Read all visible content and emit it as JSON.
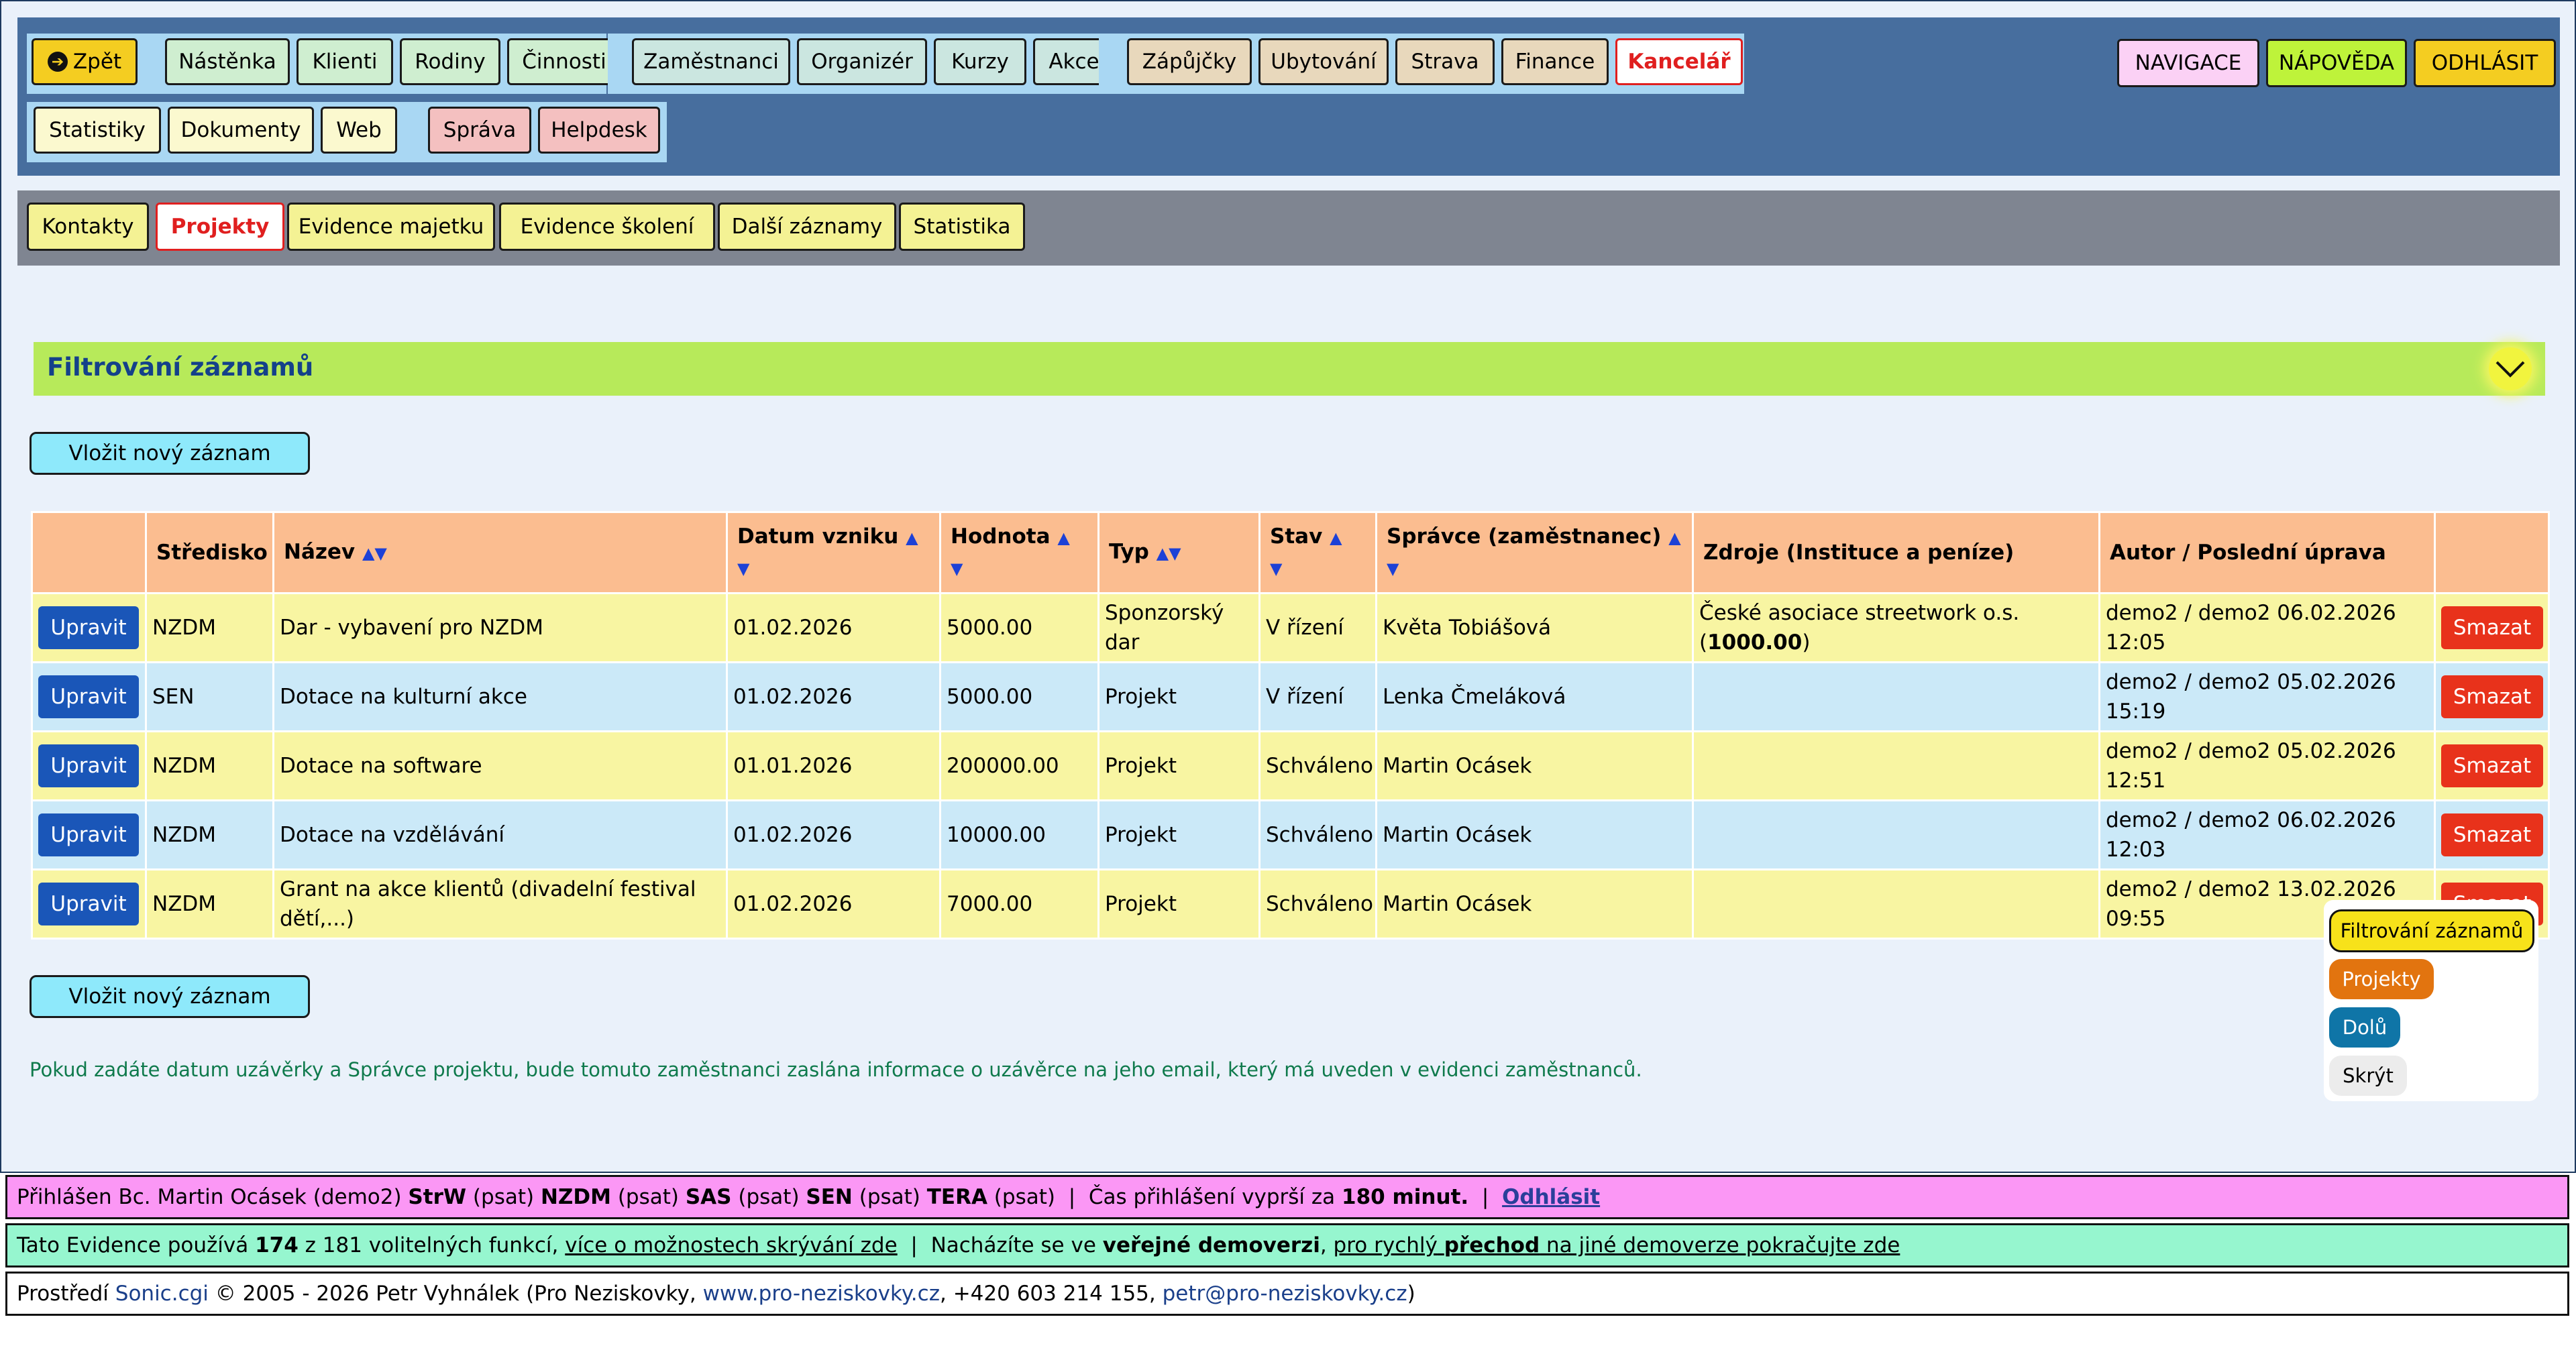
{
  "nav": {
    "back": "Zpět",
    "group1": [
      "Nástěnka",
      "Klienti",
      "Rodiny",
      "Činnosti"
    ],
    "group2": [
      "Zaměstnanci",
      "Organizér",
      "Kurzy",
      "Akce"
    ],
    "group3": [
      "Zápůjčky",
      "Ubytování",
      "Strava",
      "Finance",
      "Kancelář"
    ],
    "group4": [
      "Statistiky",
      "Dokumenty",
      "Web"
    ],
    "group5": [
      "Správa",
      "Helpdesk"
    ],
    "right": [
      "NAVIGACE",
      "NÁPOVĚDA",
      "ODHLÁSIT"
    ]
  },
  "subnav": [
    "Kontakty",
    "Projekty",
    "Evidence majetku",
    "Evidence školení",
    "Další záznamy",
    "Statistika"
  ],
  "filter": {
    "title": "Filtrování záznamů"
  },
  "insert_label": "Vložit nový záznam",
  "table": {
    "headers": {
      "stredisko": "Středisko",
      "nazev": "Název",
      "datum": "Datum vzniku",
      "hodnota": "Hodnota",
      "typ": "Typ",
      "stav": "Stav",
      "spravce": "Správce (zaměstnanec)",
      "zdroje": "Zdroje (Instituce a peníze)",
      "autor": "Autor / Poslední úprava"
    },
    "edit_label": "Upravit",
    "delete_label": "Smazat",
    "rows": [
      {
        "stredisko": "NZDM",
        "nazev": "Dar - vybavení pro NZDM",
        "datum": "01.02.2026",
        "hodnota": "5000.00",
        "typ": "Sponzorský dar",
        "stav": "V řízení",
        "spravce": "Květa Tobiášová",
        "zdroje_name": "České asociace streetwork o.s.",
        "zdroje_amount": "1000.00",
        "autor": "demo2 / demo2 06.02.2026 12:05"
      },
      {
        "stredisko": "SEN",
        "nazev": "Dotace na kulturní akce",
        "datum": "01.02.2026",
        "hodnota": "5000.00",
        "typ": "Projekt",
        "stav": "V řízení",
        "spravce": "Lenka Čmeláková",
        "zdroje_name": "",
        "zdroje_amount": "",
        "autor": "demo2 / demo2 05.02.2026 15:19"
      },
      {
        "stredisko": "NZDM",
        "nazev": "Dotace na software",
        "datum": "01.01.2026",
        "hodnota": "200000.00",
        "typ": "Projekt",
        "stav": "Schváleno",
        "spravce": "Martin Ocásek",
        "zdroje_name": "",
        "zdroje_amount": "",
        "autor": "demo2 / demo2 05.02.2026 12:51"
      },
      {
        "stredisko": "NZDM",
        "nazev": "Dotace na vzdělávání",
        "datum": "01.02.2026",
        "hodnota": "10000.00",
        "typ": "Projekt",
        "stav": "Schváleno",
        "spravce": "Martin Ocásek",
        "zdroje_name": "",
        "zdroje_amount": "",
        "autor": "demo2 / demo2 06.02.2026 12:03"
      },
      {
        "stredisko": "NZDM",
        "nazev": "Grant na akce klientů (divadelní festival dětí,...)",
        "datum": "01.02.2026",
        "hodnota": "7000.00",
        "typ": "Projekt",
        "stav": "Schváleno",
        "spravce": "Martin Ocásek",
        "zdroje_name": "",
        "zdroje_amount": "",
        "autor": "demo2 / demo2 13.02.2026 09:55"
      }
    ]
  },
  "note": "Pokud zadáte datum uzávěrky a Správce projektu, bude tomuto zaměstnanci zaslána informace o uzávěrce na jeho email, který má uveden v evidenci zaměstnanců.",
  "float_menu": [
    "Filtrování záznamů",
    "Projekty",
    "Dolů",
    "Skrýt"
  ],
  "footer": {
    "login": {
      "prefix": "Přihlášen Bc. Martin Ocásek (demo2)",
      "units": [
        {
          "code": "StrW",
          "perm": "(psat)"
        },
        {
          "code": "NZDM",
          "perm": "(psat)"
        },
        {
          "code": "SAS",
          "perm": "(psat)"
        },
        {
          "code": "SEN",
          "perm": "(psat)"
        },
        {
          "code": "TERA",
          "perm": "(psat)"
        }
      ],
      "sep": "|",
      "expires_prefix": "Čas přihlášení vyprší za",
      "expires_value": "180 minut.",
      "logout": "Odhlásit"
    },
    "features": {
      "p1": "Tato Evidence používá",
      "count": "174",
      "p2": "z 181 volitelných funkcí,",
      "link1": "více o možnostech skrývání zde",
      "sep": "|",
      "p3": "Nacházíte se ve",
      "demo": "veřejné demoverzi",
      "p4": ",",
      "link2a": "pro rychlý",
      "link2b": "přechod",
      "link2c": "na jiné demoverze pokračujte zde"
    },
    "credits": {
      "p1": "Prostředí",
      "sonic": "Sonic.cgi",
      "p2": "© 2005 - 2026 Petr Vyhnálek (Pro Neziskovky,",
      "web": "www.pro-neziskovky.cz",
      "p3": ", +420 603 214 155,",
      "email": "petr@pro-neziskovky.cz",
      "p4": ")"
    }
  },
  "colors": {
    "top_bar": "#476e9e",
    "sub_bar": "#7f8591",
    "filter_bar": "#b7ea5a",
    "header_row": "#fbbd90",
    "row_yellow": "#f8f5a2",
    "row_blue": "#cbe9f8",
    "active_red": "#e01f1f"
  }
}
